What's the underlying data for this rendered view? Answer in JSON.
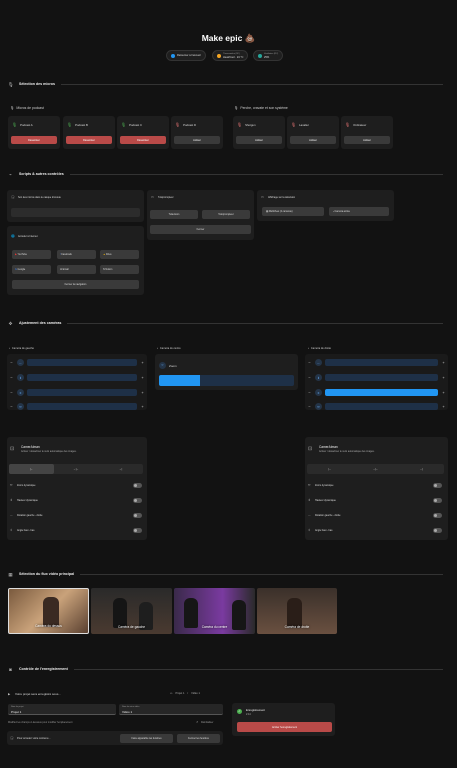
{
  "title": "Make epic",
  "status": {
    "return": "Retourner à l'accueil",
    "temp_label": "Thermomètre (RC)",
    "temp_value": "Heat/Cool · 24 °C",
    "fan_label": "Ventilateur (RC)",
    "fan_value": "25%"
  },
  "sections": {
    "mics": "Sélection des micros",
    "scripts": "Scripts & autres contrôles",
    "cameras": "Ajustement des caméras",
    "video": "Sélection du flux vidéo principal",
    "recording": "Contrôle de l'enregistrement"
  },
  "mics": {
    "podcast_title": "Micros de podcast",
    "perche_title": "Perche, cravate et son système",
    "podcast": [
      {
        "name": "Podcast A",
        "action": "Désactiver"
      },
      {
        "name": "Podcast B",
        "action": "Désactiver"
      },
      {
        "name": "Podcast C",
        "action": "Désactiver"
      },
      {
        "name": "Podcast D",
        "action": "Activer"
      }
    ],
    "perche": [
      {
        "name": "Shotgun",
        "action": "Activer"
      },
      {
        "name": "Lavalier",
        "action": "Activer"
      },
      {
        "name": "Ordinateur",
        "action": "Activer"
      }
    ]
  },
  "scripts": {
    "headphones_label": "Son des micros dans le casque d'écoute",
    "teleprompter_label": "Téléprompteur",
    "tele_btn_1": "Télévision",
    "tele_btn_2": "Téléprompteur",
    "tele_close": "Fermer",
    "tv_label": "Affichage sur la télévision",
    "tv_btn_1": "MultiView (4 caméras)",
    "tv_btn_2": "Caméra active",
    "internet_label": "Accéder à Internet",
    "links": [
      "YouTube",
      "Facebook",
      "Drive",
      "Google",
      "Email",
      "Notion"
    ],
    "close_nav": "Fermer la navigation"
  },
  "cameras": {
    "left_label": "Caméra de gauche",
    "center_label": "Caméra du centre",
    "right_label": "Caméra de droite",
    "zoom_label": "Zoom",
    "zoom_level": 0.3,
    "right_highlight_level": 0.9,
    "camerakiman_title": "CamerAIman",
    "camerakiman_desc": "Activer / désactiver le suivi automatique des images.",
    "toggles": [
      "Zoom dynamique",
      "Hauteur dynamique",
      "Rotation gauche - droite",
      "Angle haut - bas"
    ]
  },
  "video": {
    "thumbs": [
      "Caméra du dessus",
      "Caméra de gauche",
      "Caméra du centre",
      "Caméra de droite"
    ]
  },
  "recording": {
    "save_title": "Votre projet sera enregistré sous...",
    "path_1": "Projet 1",
    "path_2": "Vidéo 1",
    "project_label": "Nom du projet",
    "project_value": "Projet 1",
    "video_label": "Nom de votre vidéo",
    "video_value": "Vidéo 1",
    "hint": "Modifiez les champs ci-dessous pour modifier l'emplacement",
    "reset": "Réinitialiser",
    "preview_label": "Pour écouter votre contenu...",
    "preview_btn": "Faire apparaître les fenêtres",
    "close_btn": "Fermer les fenêtres",
    "rec_title": "Enregistrement",
    "rec_sub": "2:44",
    "rec_btn": "Arrêter l'enregistrement"
  },
  "colors": {
    "active_red": "#b94a48",
    "accent_blue": "#2196f3",
    "mic_green": "#4caf50"
  }
}
